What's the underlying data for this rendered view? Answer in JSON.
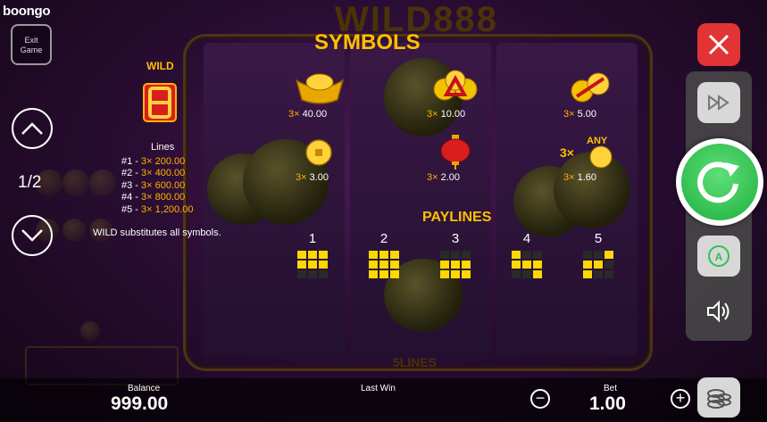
{
  "brand": {
    "logo": "boongo"
  },
  "exit": {
    "label_line1": "Exit",
    "label_line2": "Game"
  },
  "pager": {
    "indicator": "1/2"
  },
  "background_text": {
    "game_title": "WILD888",
    "lines_footer": "5LINES"
  },
  "wild": {
    "label": "WILD",
    "lines_heading": "Lines",
    "lines": [
      {
        "line": "#1 -",
        "mult": "3×",
        "value": "200.00"
      },
      {
        "line": "#2 -",
        "mult": "3×",
        "value": "400.00"
      },
      {
        "line": "#3 -",
        "mult": "3×",
        "value": "600.00"
      },
      {
        "line": "#4 -",
        "mult": "3×",
        "value": "800.00"
      },
      {
        "line": "#5 -",
        "mult": "3×",
        "value": "1,200.00"
      }
    ],
    "note": "WILD substitutes all symbols."
  },
  "symbols": {
    "title": "SYMBOLS",
    "items": [
      {
        "icon": "gold-ingot-icon",
        "mult": "3×",
        "pay": "40.00"
      },
      {
        "icon": "coins-with-ribbon-icon",
        "mult": "3×",
        "pay": "10.00"
      },
      {
        "icon": "two-coins-icon",
        "mult": "3×",
        "pay": "5.00"
      },
      {
        "icon": "single-coin-icon",
        "mult": "3×",
        "pay": "3.00"
      },
      {
        "icon": "red-lantern-icon",
        "mult": "3×",
        "pay": "2.00"
      },
      {
        "icon": "any-coin-icon",
        "mult": "3×",
        "pay": "1.60",
        "prefix": "3×",
        "any": "ANY"
      }
    ]
  },
  "paylines": {
    "title": "PAYLINES",
    "lines": [
      {
        "number": "1",
        "pattern": [
          1,
          1,
          1,
          1,
          1,
          1,
          0,
          0,
          0
        ]
      },
      {
        "number": "2",
        "pattern": [
          1,
          1,
          1,
          1,
          1,
          1,
          1,
          1,
          1
        ]
      },
      {
        "number": "3",
        "pattern": [
          0,
          0,
          0,
          1,
          1,
          1,
          1,
          1,
          1
        ]
      },
      {
        "number": "4",
        "pattern": [
          1,
          0,
          0,
          1,
          1,
          1,
          0,
          0,
          1
        ]
      },
      {
        "number": "5",
        "pattern": [
          0,
          0,
          1,
          1,
          1,
          0,
          1,
          0,
          0
        ]
      }
    ]
  },
  "footer": {
    "balance_label": "Balance",
    "balance_value": "999.00",
    "last_win_label": "Last Win",
    "bet_label": "Bet",
    "bet_value": "1.00"
  },
  "colors": {
    "accent": "#ffc000",
    "spin": "#2ec24f",
    "close": "#e23434"
  }
}
